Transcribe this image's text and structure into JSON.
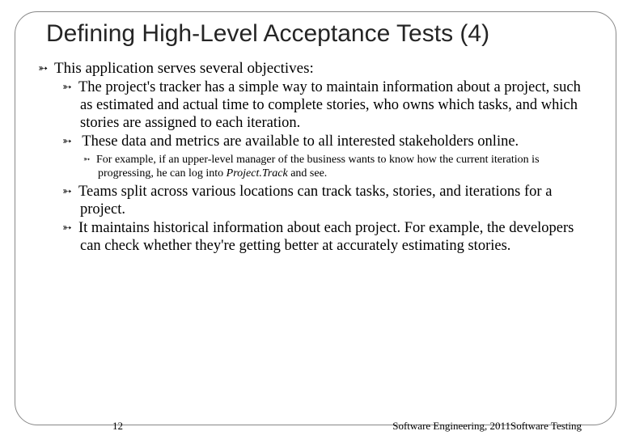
{
  "title": "Defining High-Level Acceptance Tests (4)",
  "bullets": {
    "intro": "This application serves several objectives:",
    "b1": "The project's tracker has a simple way to maintain information about a project, such as estimated and actual time to complete stories, who owns which tasks, and which stories are assigned to each iteration.",
    "b2": " These data and metrics are available to all interested stakeholders online.",
    "b2a_pre": "For example, if an upper-level manager of the business wants to know how the current iteration is progressing, he can log into ",
    "b2a_it": "Project.Track",
    "b2a_post": " and see.",
    "b3": "Teams split across various locations can track tasks, stories, and iterations for a project.",
    "b4": "It maintains historical information about each project. For example, the developers can check whether they're getting better at accurately estimating stories."
  },
  "footer": {
    "page": "12",
    "right": "Software Engineering,   2011Software  Testing"
  }
}
